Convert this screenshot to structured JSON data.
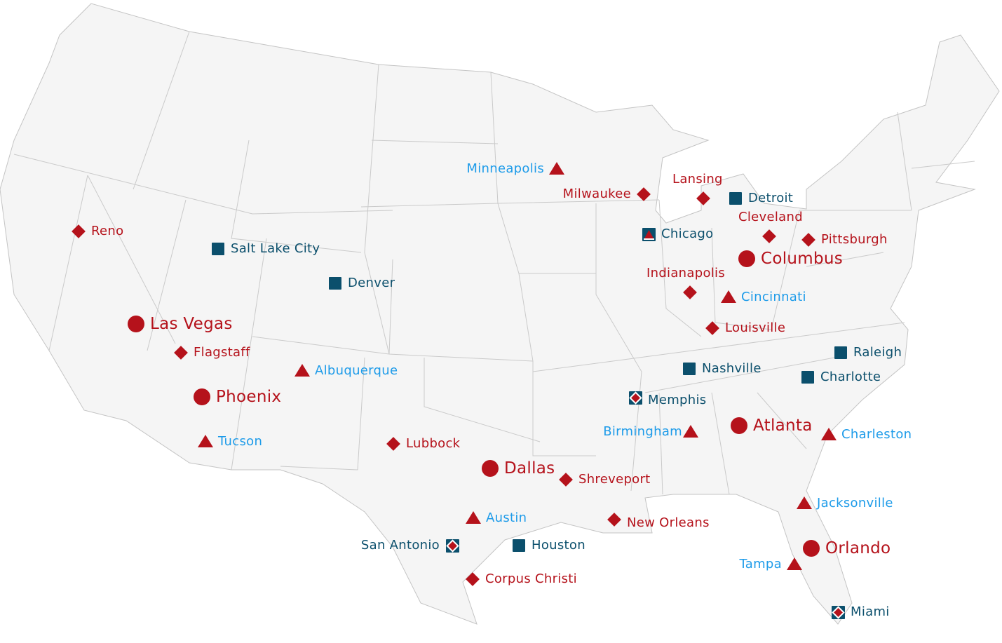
{
  "colors": {
    "marker_red": "#b5121b",
    "marker_teal": "#0b4f6c",
    "label_red": "#b5121b",
    "label_blue": "#1d9be9",
    "label_teal": "#0b4f6c",
    "land": "#f5f5f5",
    "border": "#c8c8c8"
  },
  "marker_types": {
    "circle": "circle-icon",
    "diamond": "diamond-icon",
    "triangle": "triangle-icon",
    "square": "square-icon",
    "square-triangle": "square-triangle-icon",
    "square-diamond": "square-diamond-icon"
  },
  "cities": [
    {
      "name": "Minneapolis",
      "type": "triangle"
    },
    {
      "name": "Milwaukee",
      "type": "diamond"
    },
    {
      "name": "Lansing",
      "type": "diamond"
    },
    {
      "name": "Detroit",
      "type": "square"
    },
    {
      "name": "Chicago",
      "type": "square-triangle"
    },
    {
      "name": "Cleveland",
      "type": "diamond"
    },
    {
      "name": "Pittsburgh",
      "type": "diamond"
    },
    {
      "name": "Columbus",
      "type": "circle"
    },
    {
      "name": "Indianapolis",
      "type": "diamond"
    },
    {
      "name": "Cincinnati",
      "type": "triangle"
    },
    {
      "name": "Louisville",
      "type": "diamond"
    },
    {
      "name": "Reno",
      "type": "diamond"
    },
    {
      "name": "Salt Lake City",
      "type": "square"
    },
    {
      "name": "Denver",
      "type": "square"
    },
    {
      "name": "Las Vegas",
      "type": "circle"
    },
    {
      "name": "Flagstaff",
      "type": "diamond"
    },
    {
      "name": "Albuquerque",
      "type": "triangle"
    },
    {
      "name": "Phoenix",
      "type": "circle"
    },
    {
      "name": "Tucson",
      "type": "triangle"
    },
    {
      "name": "Lubbock",
      "type": "diamond"
    },
    {
      "name": "Dallas",
      "type": "circle"
    },
    {
      "name": "Shreveport",
      "type": "diamond"
    },
    {
      "name": "Austin",
      "type": "triangle"
    },
    {
      "name": "San Antonio",
      "type": "square-diamond"
    },
    {
      "name": "Houston",
      "type": "square"
    },
    {
      "name": "Corpus Christi",
      "type": "diamond"
    },
    {
      "name": "New Orleans",
      "type": "diamond"
    },
    {
      "name": "Memphis",
      "type": "square-diamond"
    },
    {
      "name": "Nashville",
      "type": "square"
    },
    {
      "name": "Raleigh",
      "type": "square"
    },
    {
      "name": "Charlotte",
      "type": "square"
    },
    {
      "name": "Birmingham",
      "type": "triangle"
    },
    {
      "name": "Atlanta",
      "type": "circle"
    },
    {
      "name": "Charleston",
      "type": "triangle"
    },
    {
      "name": "Jacksonville",
      "type": "triangle"
    },
    {
      "name": "Orlando",
      "type": "circle"
    },
    {
      "name": "Tampa",
      "type": "triangle"
    },
    {
      "name": "Miami",
      "type": "square-diamond"
    }
  ]
}
